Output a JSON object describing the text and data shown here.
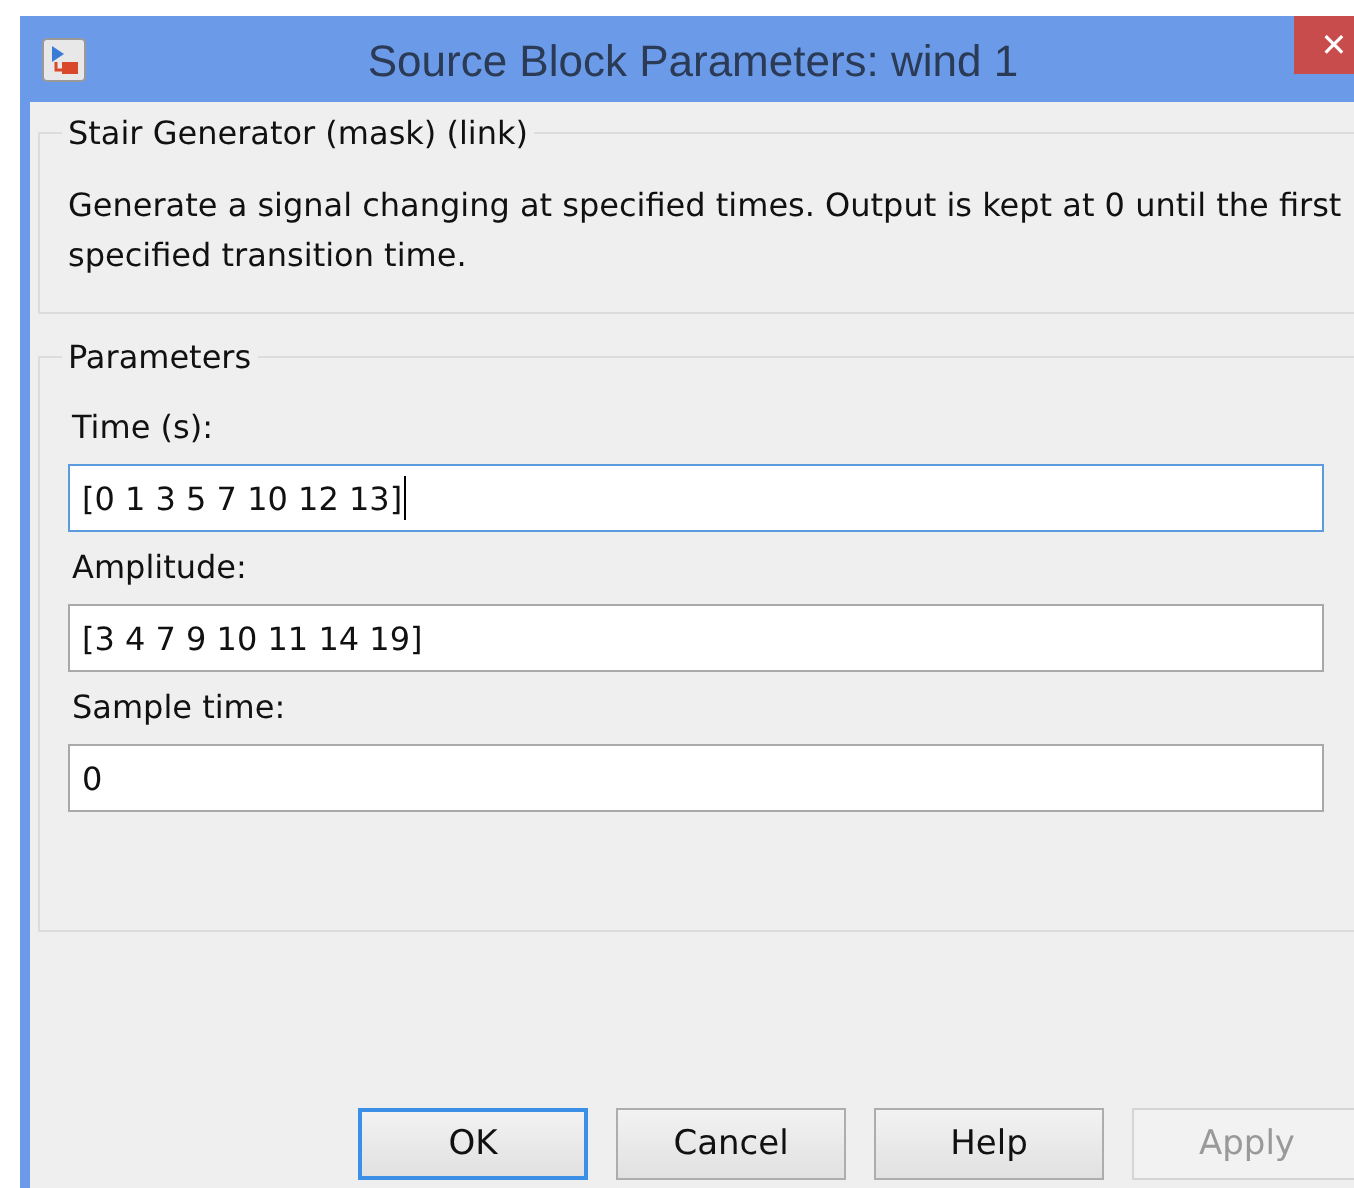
{
  "window": {
    "title": "Source Block Parameters: wind 1",
    "close": "✕"
  },
  "description_group": {
    "title": "Stair Generator (mask) (link)",
    "text": "Generate a signal changing at specified times. Output is kept at 0 until the first specified transition time."
  },
  "parameters_group": {
    "title": "Parameters",
    "fields": [
      {
        "label": "Time (s):",
        "value": "[0 1 3 5 7 10 12 13]",
        "focused": true
      },
      {
        "label": "Amplitude:",
        "value": "[3 4 7 9 10 11 14 19]",
        "focused": false
      },
      {
        "label": "Sample time:",
        "value": "0",
        "focused": false
      }
    ]
  },
  "buttons": [
    {
      "label": "OK",
      "default": true,
      "disabled": false
    },
    {
      "label": "Cancel",
      "default": false,
      "disabled": false
    },
    {
      "label": "Help",
      "default": false,
      "disabled": false
    },
    {
      "label": "Apply",
      "default": false,
      "disabled": true
    }
  ]
}
